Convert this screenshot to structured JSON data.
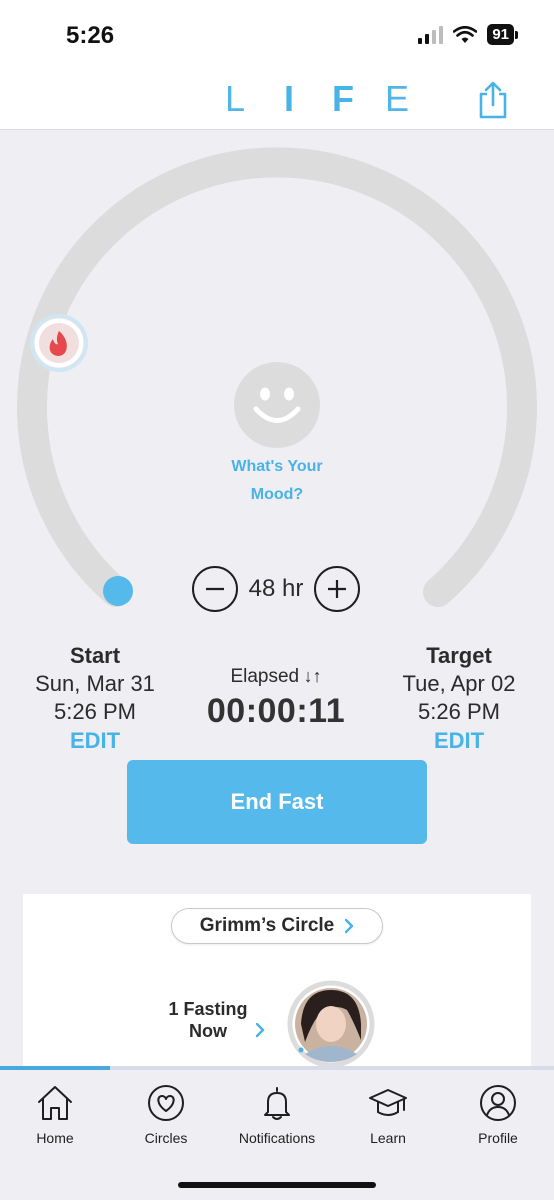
{
  "status_bar": {
    "time": "5:26",
    "battery": "91"
  },
  "header": {
    "logo_letters": [
      "L",
      "I",
      "F",
      "E"
    ]
  },
  "dial": {
    "mood_prompt_line1": "What's Your",
    "mood_prompt_line2": "Mood?",
    "duration_label": "48 hr",
    "progress_fraction": 0.0
  },
  "start": {
    "title": "Start",
    "date": "Sun, Mar 31",
    "time": "5:26 PM",
    "edit": "EDIT"
  },
  "elapsed": {
    "label": "Elapsed",
    "arrows": "↓↑",
    "value": "00:00:11"
  },
  "target": {
    "title": "Target",
    "date": "Tue, Apr 02",
    "time": "5:26 PM",
    "edit": "EDIT"
  },
  "end_button": "End Fast",
  "circle_card": {
    "circle_name": "Grimm’s Circle",
    "fasting_line1": "1 Fasting",
    "fasting_line2": "Now"
  },
  "tabs": [
    {
      "label": "Home",
      "icon": "home-icon"
    },
    {
      "label": "Circles",
      "icon": "heart-circle-icon"
    },
    {
      "label": "Notifications",
      "icon": "bell-icon"
    },
    {
      "label": "Learn",
      "icon": "graduation-cap-icon"
    },
    {
      "label": "Profile",
      "icon": "profile-icon"
    }
  ],
  "colors": {
    "accent": "#48b3e6",
    "button": "#56b9eb",
    "track": "#dcdcdc",
    "background": "#efeef3"
  }
}
